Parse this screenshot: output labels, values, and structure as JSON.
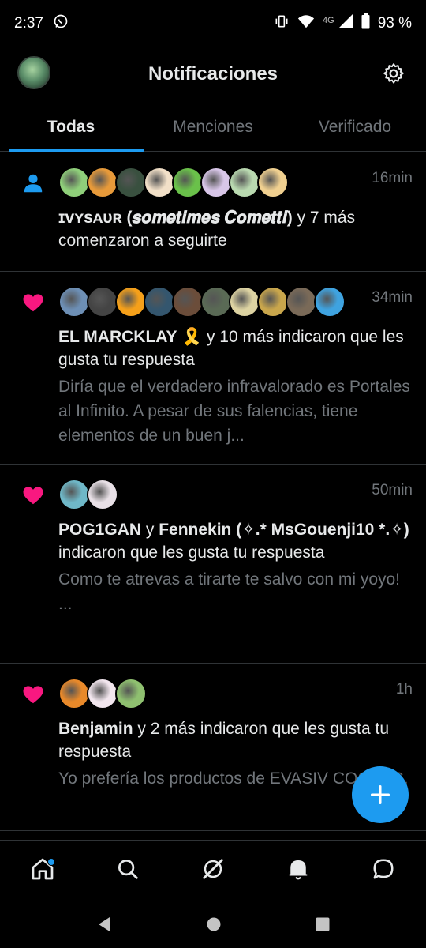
{
  "status_bar": {
    "time": "2:37",
    "network": "4G",
    "battery": "93 %"
  },
  "header": {
    "title": "Notificaciones"
  },
  "tabs": [
    {
      "label": "Todas",
      "active": true
    },
    {
      "label": "Menciones",
      "active": false
    },
    {
      "label": "Verificado",
      "active": false
    }
  ],
  "notifications": [
    {
      "type": "follow",
      "time": "16min",
      "avatar_colors": [
        "#8fcf7a",
        "#e79a3a",
        "#39503f",
        "#f2e0c8",
        "#6ac14a",
        "#d8c6e8",
        "#b9d9b0",
        "#f0d090"
      ],
      "actor": "ɪᴠʏsᴀᴜʀ (𝒔𝒐𝒎𝒆𝒕𝒊𝒎𝒆𝒔 𝑪𝒐𝒎𝒆𝒕𝒕𝒊)",
      "rest": " y 7 más comenzaron a seguirte",
      "preview": ""
    },
    {
      "type": "like",
      "time": "34min",
      "avatar_colors": [
        "#6d8fb5",
        "#444",
        "#f5a01a",
        "#34566e",
        "#6b4d3a",
        "#5a6a55",
        "#ddd3a2",
        "#c9a64c",
        "#7a6a58",
        "#3fa3e0"
      ],
      "actor": "EL MARCKLAY 🎗️",
      "rest": " y 10 más indicaron que les gusta tu respuesta",
      "preview": "Diría que el verdadero infravalorado es Portales al Infinito. A pesar de sus falencias, tiene elementos de un buen j..."
    },
    {
      "type": "like",
      "time": "50min",
      "avatar_colors": [
        "#6fb8c8",
        "#e8e0e6"
      ],
      "actor": "POG1GAN",
      "rest_mid": " y ",
      "actor2": "Fennekin (✧.* MsGouenji10 *.✧)",
      "rest": " indicaron que les gusta tu respuesta",
      "preview": "Como te atrevas a tirarte te salvo con mi yoyo!\n..."
    },
    {
      "type": "like",
      "time": "1h",
      "avatar_colors": [
        "#e8892a",
        "#f2e6ee",
        "#8fc070"
      ],
      "actor": "Benjamin",
      "rest": " y 2 más indicaron que les gusta tu respuesta",
      "preview": "Yo prefería los productos de EVASIV COCHES."
    }
  ],
  "icons": {
    "follow": "person-icon",
    "like": "heart-icon",
    "accent": "#1d9bf0",
    "like_color": "#f91880"
  }
}
